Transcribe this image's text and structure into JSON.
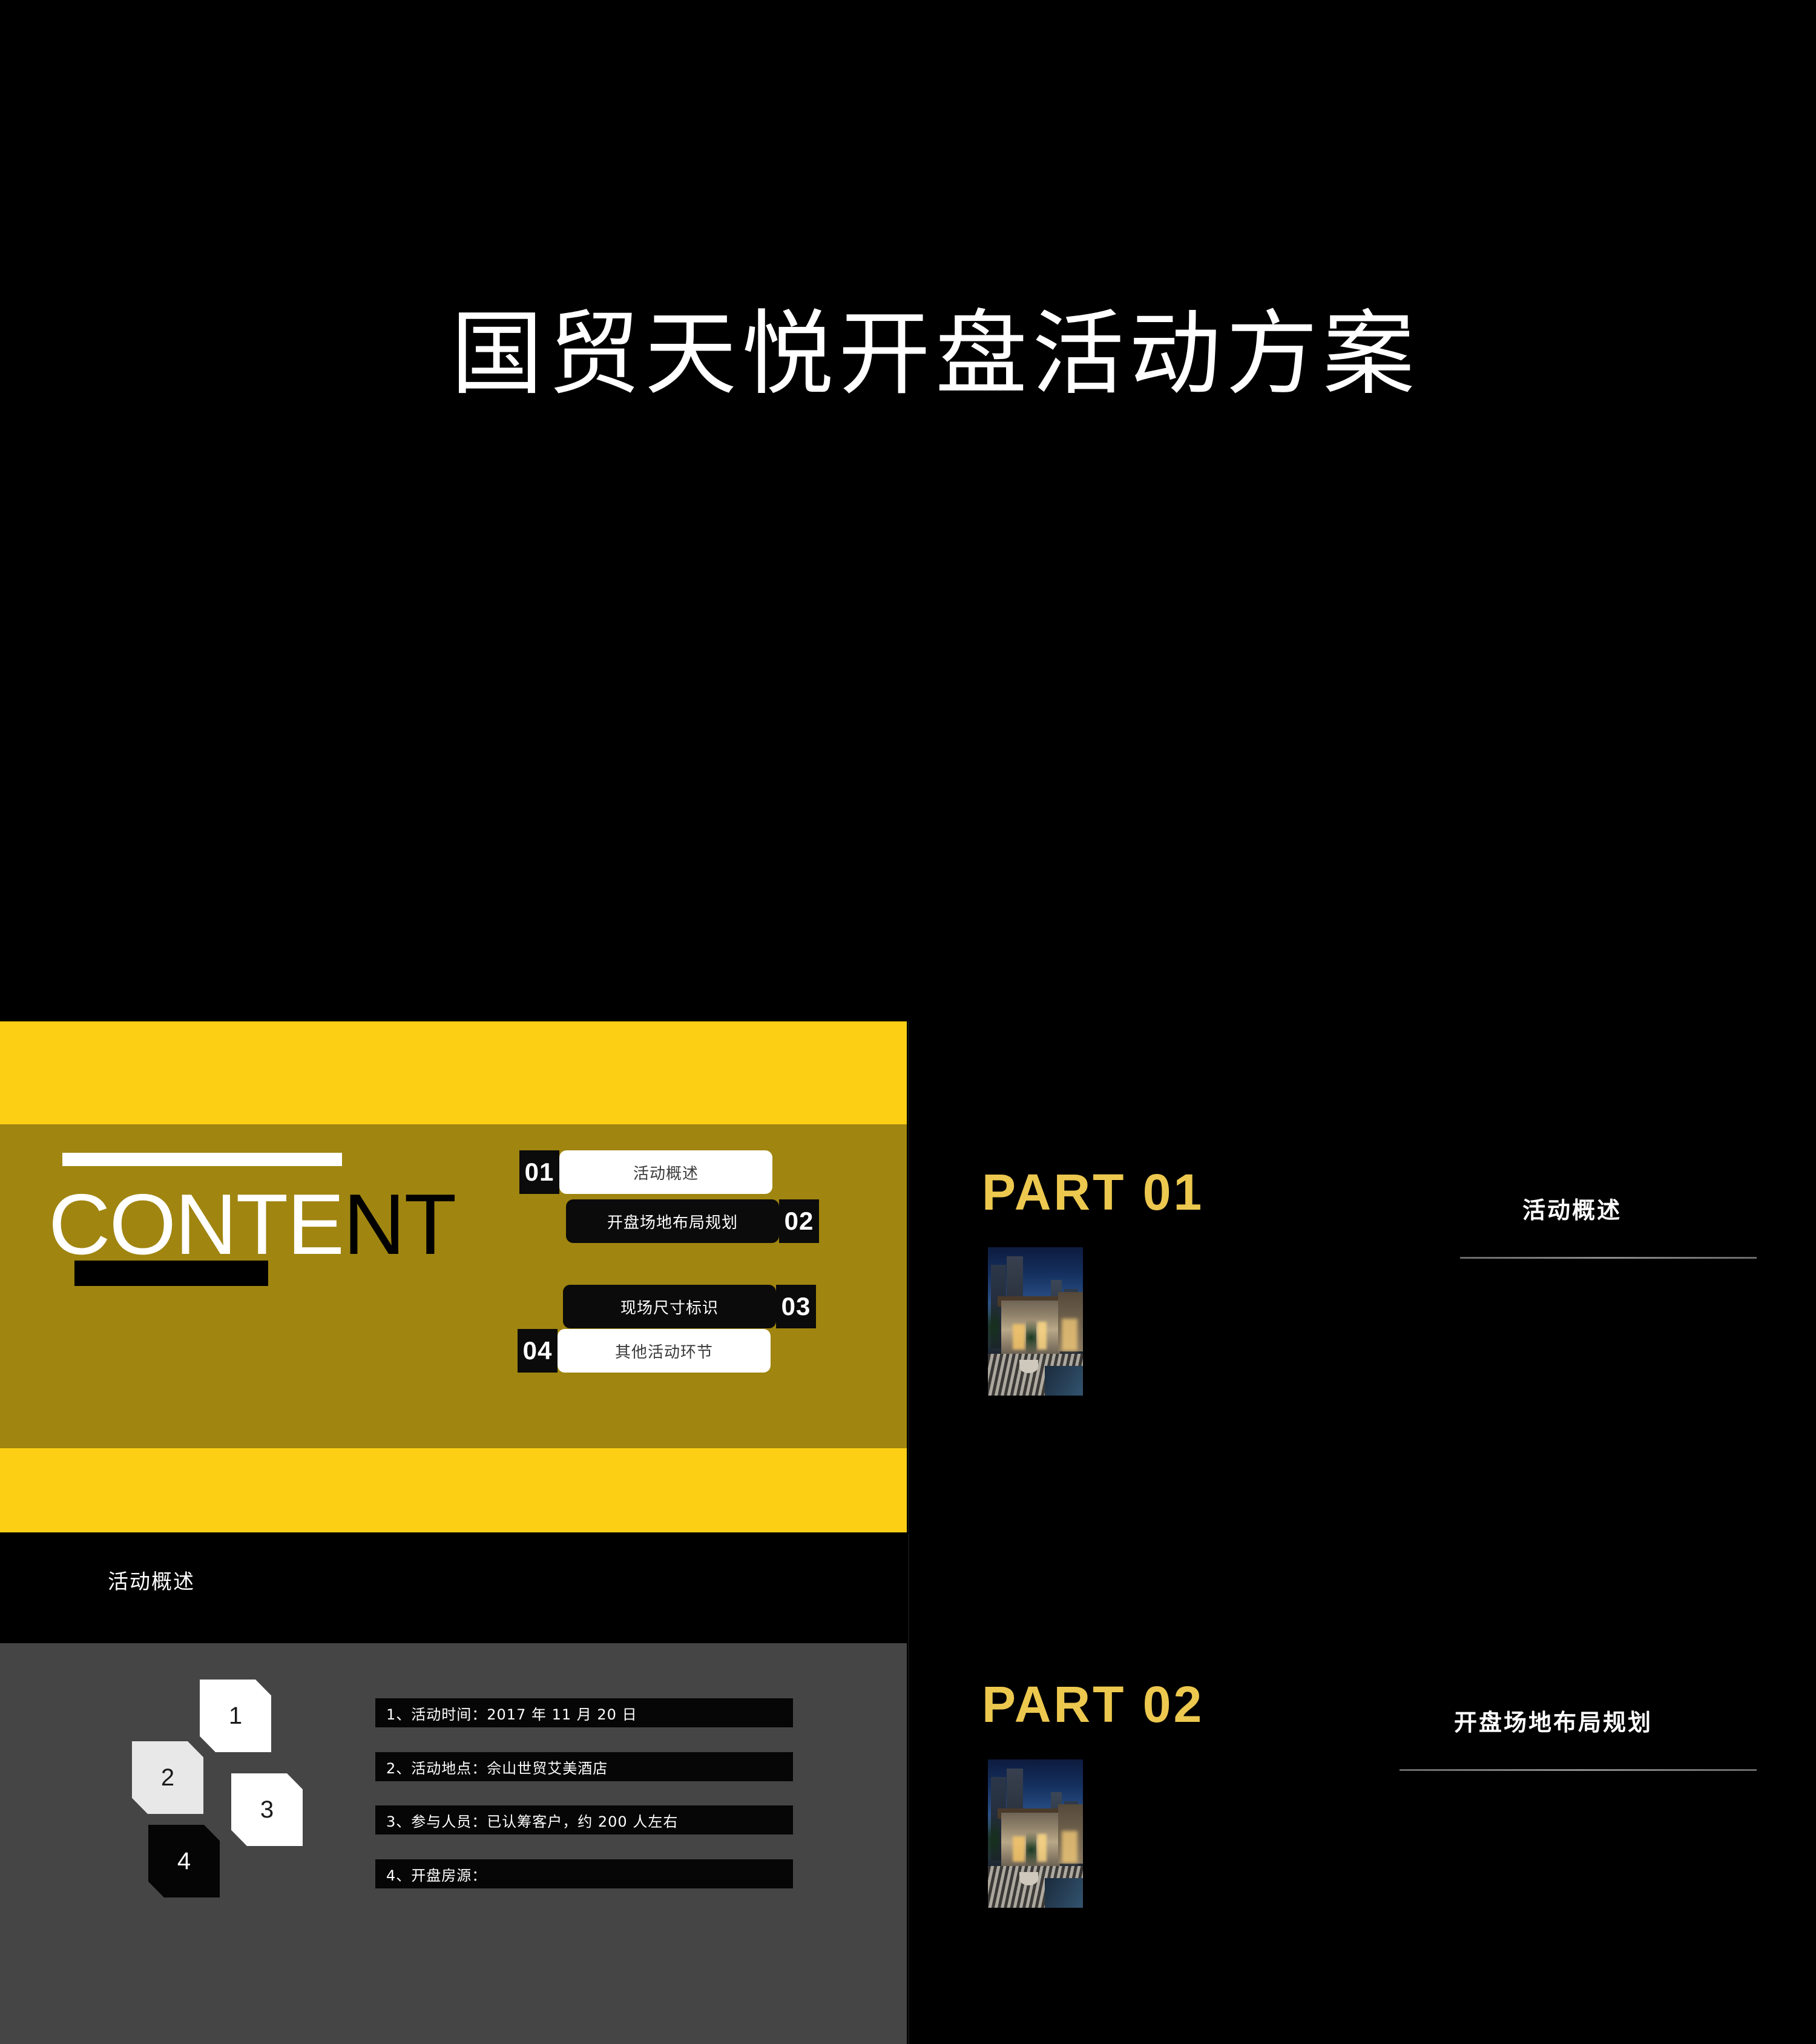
{
  "title_slide": {
    "title": "国贸天悦开盘活动方案"
  },
  "content_slide": {
    "heading_white": "CONTE",
    "heading_black": "NT",
    "items": [
      {
        "num": "01",
        "label": "活动概述"
      },
      {
        "num": "02",
        "label": "开盘场地布局规划"
      },
      {
        "num": "03",
        "label": "现场尺寸标识"
      },
      {
        "num": "04",
        "label": "其他活动环节"
      }
    ]
  },
  "part01_slide": {
    "heading": "PART 01",
    "subtitle": "活动概述",
    "photo_alt": "luxury-residence-at-dusk"
  },
  "overview_slide": {
    "page_title": "活动概述",
    "steps": [
      {
        "num": "1"
      },
      {
        "num": "2"
      },
      {
        "num": "3"
      },
      {
        "num": "4"
      }
    ],
    "bullets": [
      "1、活动时间：2017 年 11 月 20 日",
      "2、活动地点：佘山世贸艾美酒店",
      "3、参与人员：已认筹客户，约 200 人左右",
      "4、开盘房源："
    ]
  },
  "part02_slide": {
    "heading": "PART 02",
    "subtitle": "开盘场地布局规划",
    "photo_alt": "luxury-residence-at-dusk"
  },
  "colors": {
    "bright_yellow": "#FCCF14",
    "olive_gold": "#A08510",
    "part_gold": "#EDC84F",
    "gray_panel": "#454545",
    "black": "#000000",
    "white": "#FFFFFF"
  }
}
